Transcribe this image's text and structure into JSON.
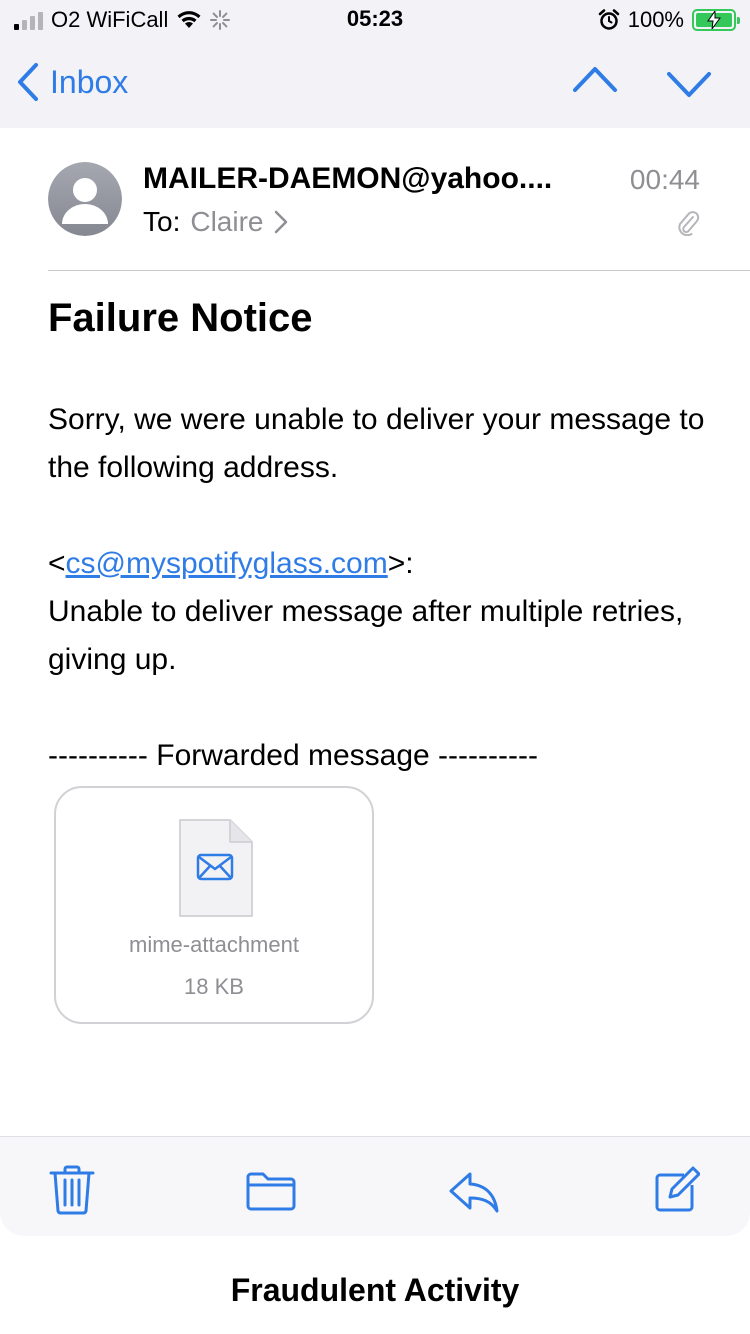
{
  "status_bar": {
    "carrier": "O2 WiFiCall",
    "time": "05:23",
    "battery": "100%",
    "icons": [
      "signal-icon",
      "wifi-icon",
      "loading-icon",
      "alarm-icon",
      "battery-charging-icon"
    ]
  },
  "nav": {
    "back_label": "Inbox",
    "icons": [
      "chevron-left-icon",
      "chevron-up-icon",
      "chevron-down-icon"
    ]
  },
  "email": {
    "sender": "MAILER-DAEMON@yahoo....",
    "time": "00:44",
    "to_label": "To:",
    "recipient": "Claire",
    "subject": "Failure Notice",
    "paragraph1": "Sorry, we were unable to deliver your message to the following address.",
    "address_open": "<",
    "address": "cs@myspotifyglass.com",
    "address_close": ">:",
    "paragraph2": "Unable to deliver message after multiple retries, giving up.",
    "forwarded": "---------- Forwarded message ----------"
  },
  "attachment": {
    "name": "mime-attachment",
    "size": "18 KB"
  },
  "toolbar": {
    "icons": [
      "trash-icon",
      "folder-icon",
      "reply-icon",
      "compose-icon"
    ]
  },
  "sheet": {
    "title": "Fraudulent Activity"
  },
  "colors": {
    "accent": "#2f7ce6",
    "secondary_text": "#8e8e93",
    "battery": "#34c759",
    "bar_background": "#f2f2f7"
  }
}
